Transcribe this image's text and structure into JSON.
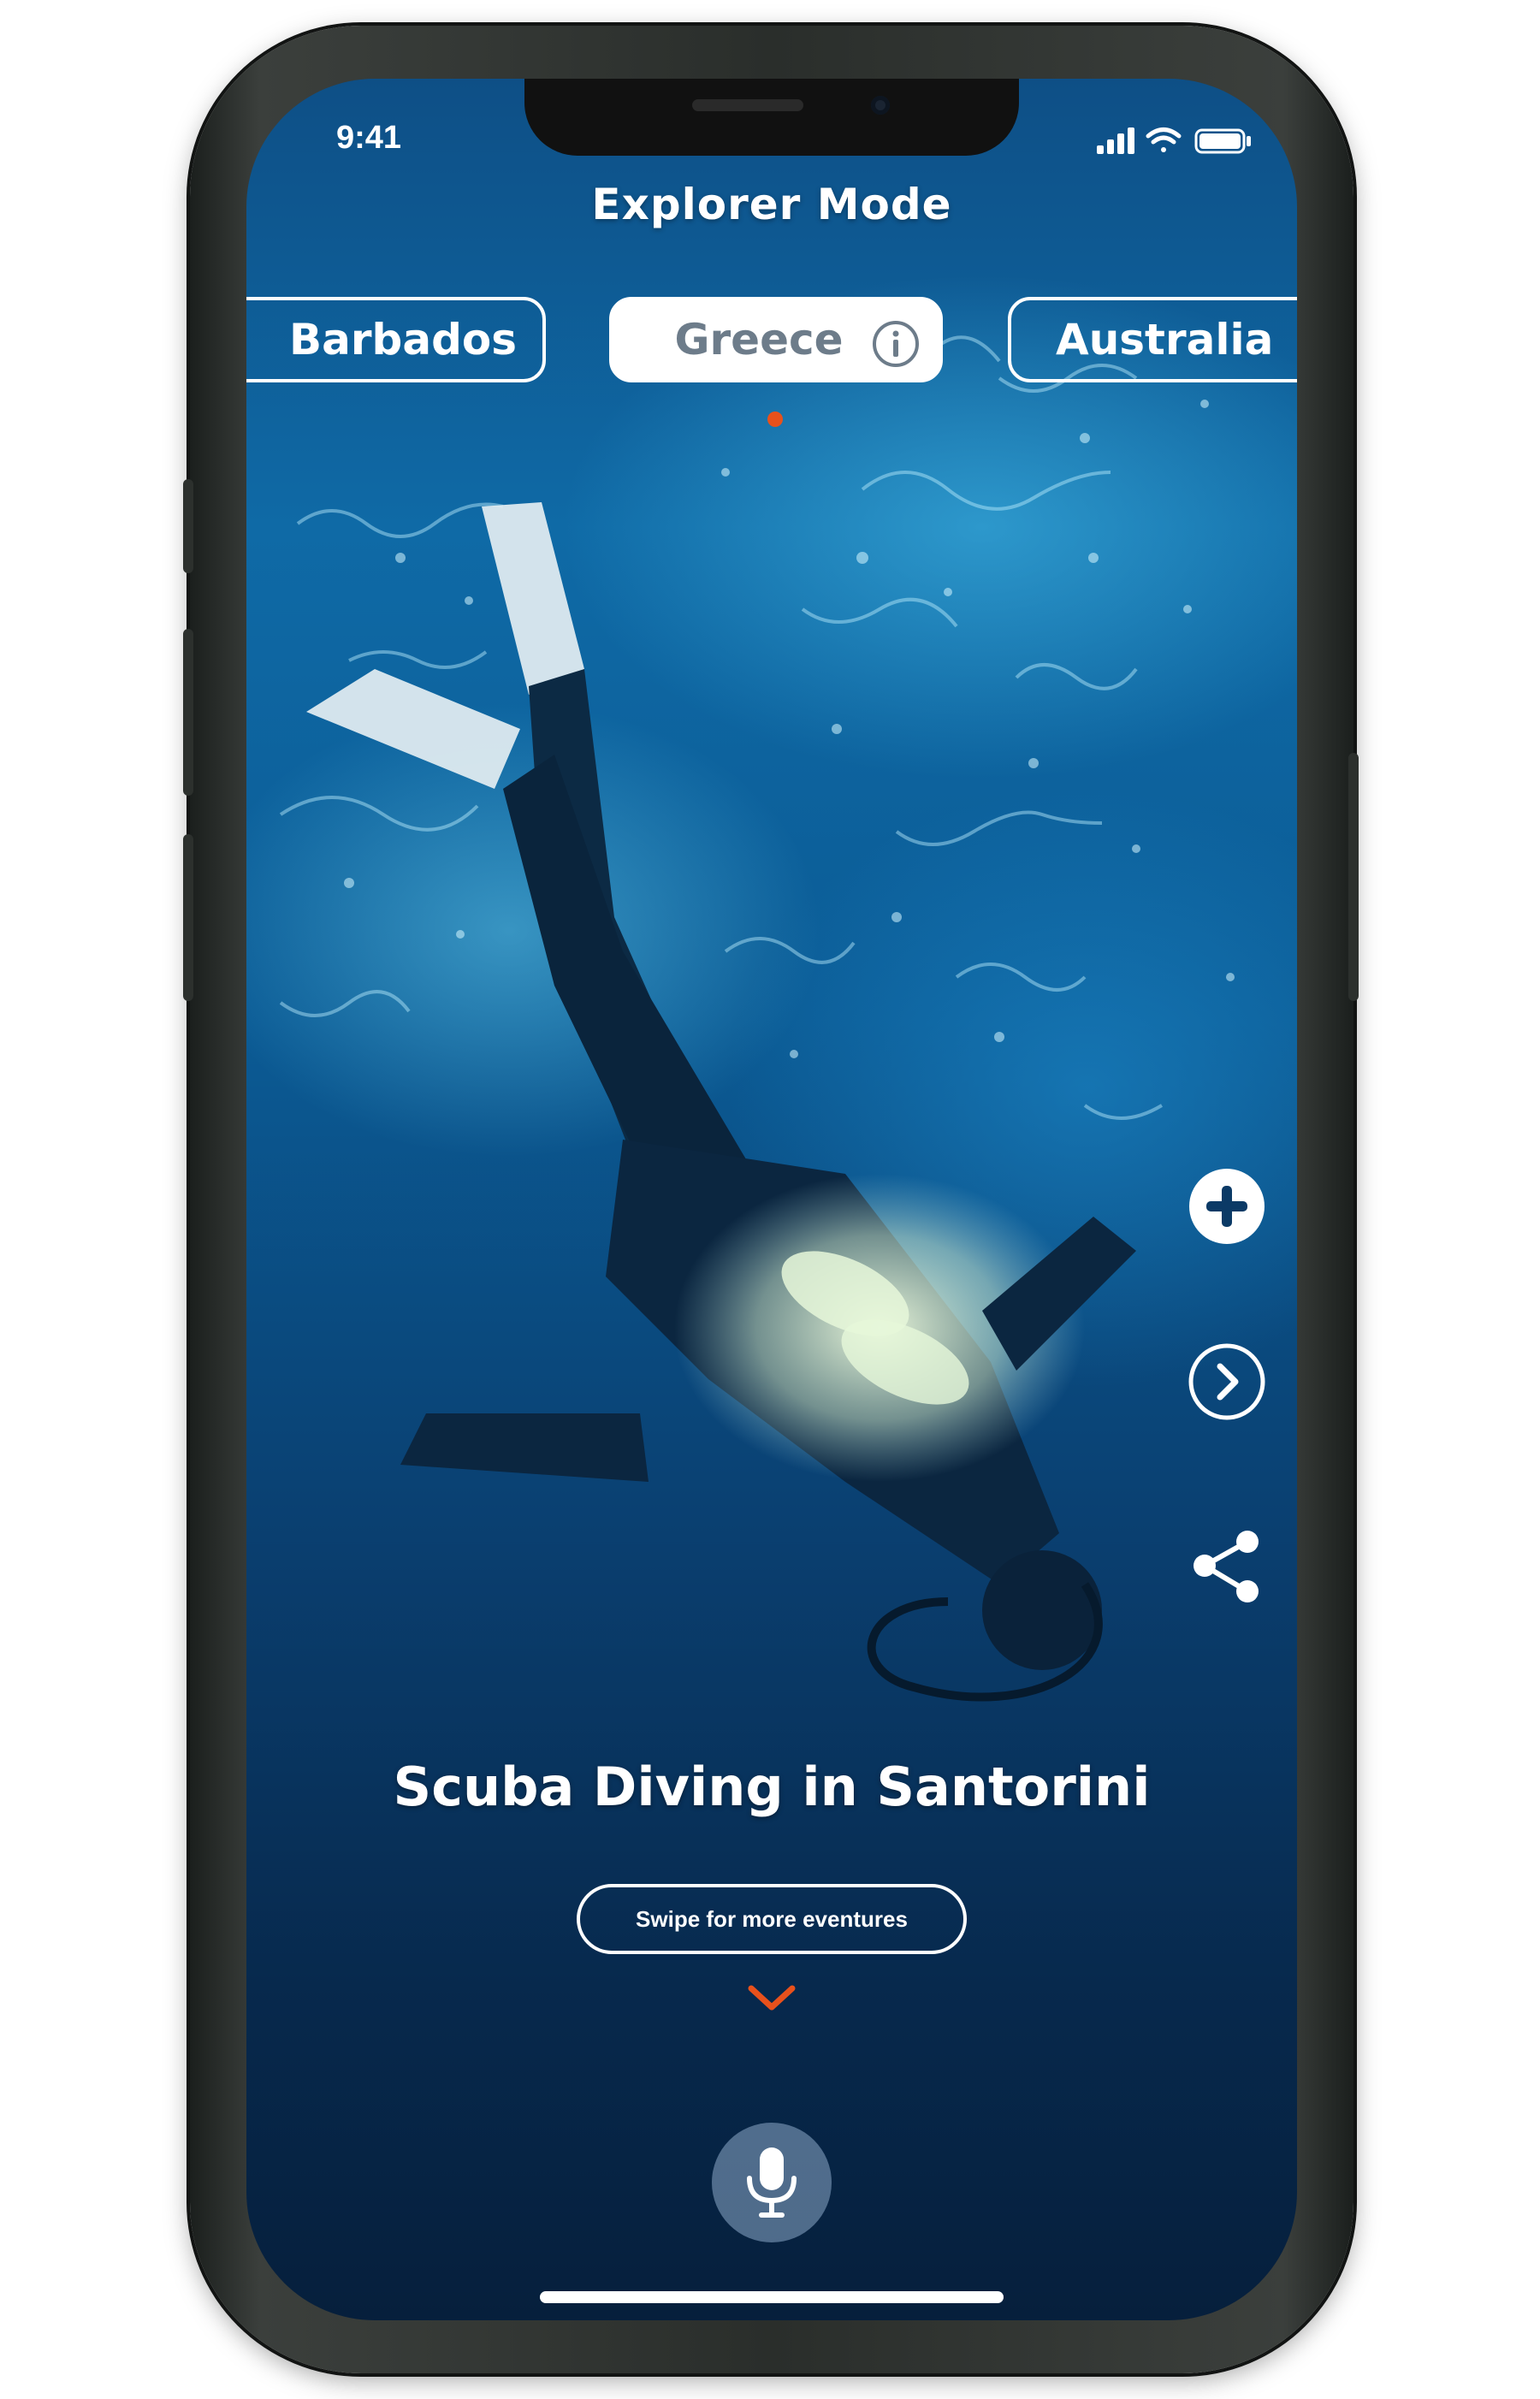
{
  "status_bar": {
    "time": "9:41"
  },
  "header": {
    "title": "Explorer Mode"
  },
  "tabs": [
    {
      "label": "Barbados"
    },
    {
      "label": "Greece"
    },
    {
      "label": "Australia"
    }
  ],
  "active_tab_index": 1,
  "main": {
    "headline": "Scuba Diving in Santorini",
    "swipe_hint": "Swipe for more eventures"
  },
  "side_actions": [
    {
      "icon": "plus-icon"
    },
    {
      "icon": "chevron-right-icon"
    },
    {
      "icon": "share-icon"
    }
  ],
  "colors": {
    "accent": "#e8511c",
    "ocean_dark": "#07294d",
    "ocean_light": "#46bee6",
    "active_tab_text": "#6d7c8a"
  }
}
